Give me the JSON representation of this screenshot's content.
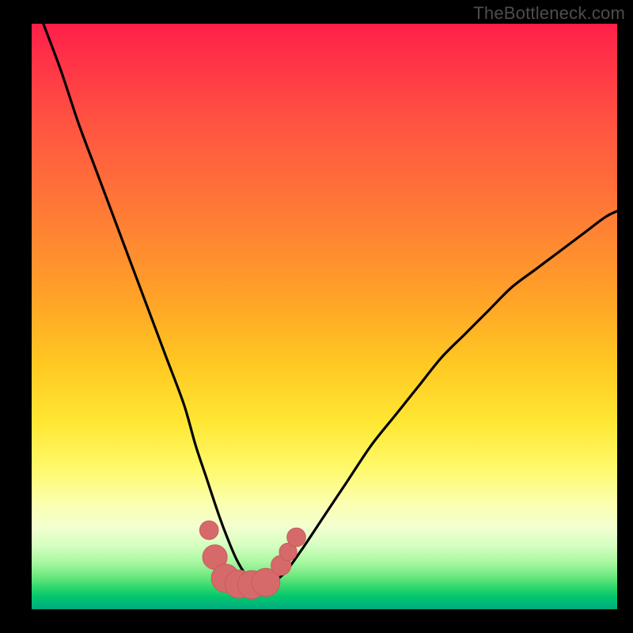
{
  "watermark": "TheBottleneck.com",
  "colors": {
    "background": "#000000",
    "curve": "#000000",
    "marker_fill": "#d66a6a",
    "marker_stroke": "#c95a5a"
  },
  "chart_data": {
    "type": "line",
    "title": "",
    "xlabel": "",
    "ylabel": "",
    "xlim": [
      0,
      100
    ],
    "ylim": [
      0,
      100
    ],
    "grid": false,
    "series": [
      {
        "name": "bottleneck-curve",
        "x": [
          2,
          5,
          8,
          11,
          14,
          17,
          20,
          23,
          26,
          28,
          30,
          32,
          33.5,
          35,
          36.5,
          38,
          40,
          43,
          46,
          50,
          54,
          58,
          62,
          66,
          70,
          74,
          78,
          82,
          86,
          90,
          94,
          98,
          100
        ],
        "y": [
          100,
          92,
          83,
          75,
          67,
          59,
          51,
          43,
          35,
          28,
          22,
          16,
          12,
          8.5,
          6,
          4.5,
          4,
          6,
          10,
          16,
          22,
          28,
          33,
          38,
          43,
          47,
          51,
          55,
          58,
          61,
          64,
          67,
          68
        ]
      }
    ],
    "markers": [
      {
        "x": 30.3,
        "y": 13.5,
        "r": 1.6
      },
      {
        "x": 31.3,
        "y": 8.9,
        "r": 2.1
      },
      {
        "x": 33.1,
        "y": 5.3,
        "r": 2.4
      },
      {
        "x": 35.4,
        "y": 4.3,
        "r": 2.4
      },
      {
        "x": 37.6,
        "y": 4.2,
        "r": 2.4
      },
      {
        "x": 40.0,
        "y": 4.6,
        "r": 2.4
      },
      {
        "x": 42.6,
        "y": 7.5,
        "r": 1.7
      },
      {
        "x": 43.8,
        "y": 9.8,
        "r": 1.5
      },
      {
        "x": 45.2,
        "y": 12.3,
        "r": 1.6
      }
    ],
    "note": "x and y are in percent of the plot area; y measured from bottom. Curve dips to a flat minimum near x≈35–40 and rises asymmetrically on both sides."
  }
}
